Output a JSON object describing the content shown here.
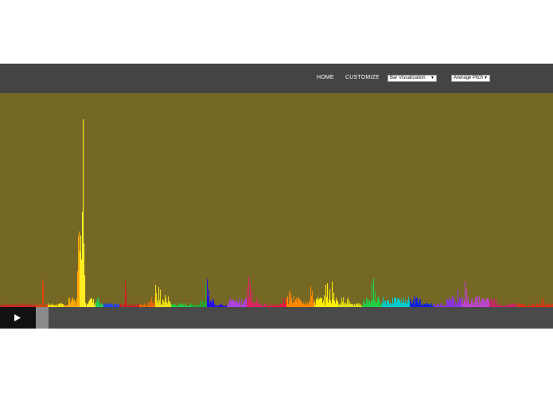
{
  "nav": {
    "home_label": "HOME",
    "customize_label": "CUSTOMIZE"
  },
  "visualization_select": {
    "selected": "Bar Visualization"
  },
  "metric_select": {
    "selected": "Average Pitch"
  },
  "colors": {
    "topbar": "#444444",
    "background": "#756825",
    "player_bar": "#4a4a4a",
    "play_button": "#111111",
    "scrub_handle": "#8a8a8a"
  },
  "icons": {
    "play": "play-icon",
    "dropdown": "chevron-down-icon"
  },
  "player": {
    "progress": 0.07
  }
}
